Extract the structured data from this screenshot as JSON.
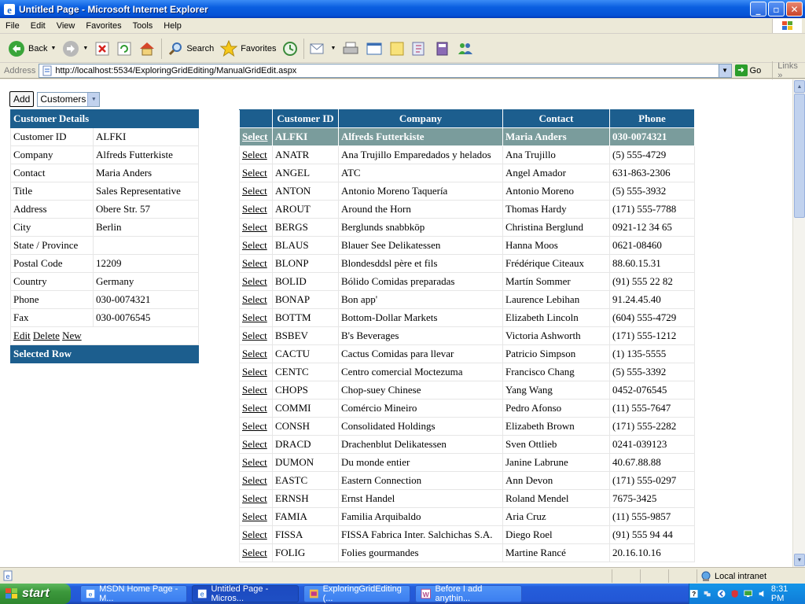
{
  "window": {
    "title": "Untitled Page - Microsoft Internet Explorer"
  },
  "menu": [
    "File",
    "Edit",
    "View",
    "Favorites",
    "Tools",
    "Help"
  ],
  "toolbar": {
    "back": "Back",
    "search": "Search",
    "favorites": "Favorites"
  },
  "address": {
    "label": "Address",
    "url": "http://localhost:5534/ExploringGridEditing/ManualGridEdit.aspx",
    "go": "Go",
    "links": "Links"
  },
  "page": {
    "add_button": "Add",
    "table_select": "Customers",
    "details": {
      "header": "Customer Details",
      "rows": [
        {
          "label": "Customer ID",
          "value": "ALFKI"
        },
        {
          "label": "Company",
          "value": "Alfreds Futterkiste"
        },
        {
          "label": "Contact",
          "value": "Maria Anders"
        },
        {
          "label": "Title",
          "value": "Sales Representative"
        },
        {
          "label": "Address",
          "value": "Obere Str. 57"
        },
        {
          "label": "City",
          "value": "Berlin"
        },
        {
          "label": "State / Province",
          "value": ""
        },
        {
          "label": "Postal Code",
          "value": "12209"
        },
        {
          "label": "Country",
          "value": "Germany"
        },
        {
          "label": "Phone",
          "value": "030-0074321"
        },
        {
          "label": "Fax",
          "value": "030-0076545"
        }
      ],
      "actions": {
        "edit": "Edit",
        "delete": "Delete",
        "new": "New"
      },
      "footer": "Selected Row"
    },
    "grid": {
      "headers": [
        "",
        "Customer ID",
        "Company",
        "Contact",
        "Phone"
      ],
      "select_label": "Select",
      "rows": [
        {
          "id": "ALFKI",
          "company": "Alfreds Futterkiste",
          "contact": "Maria Anders",
          "phone": "030-0074321",
          "selected": true
        },
        {
          "id": "ANATR",
          "company": "Ana Trujillo Emparedados y helados",
          "contact": "Ana Trujillo",
          "phone": "(5) 555-4729"
        },
        {
          "id": "ANGEL",
          "company": "ATC",
          "contact": "Angel Amador",
          "phone": "631-863-2306"
        },
        {
          "id": "ANTON",
          "company": "Antonio Moreno Taquería",
          "contact": "Antonio Moreno",
          "phone": "(5) 555-3932"
        },
        {
          "id": "AROUT",
          "company": "Around the Horn",
          "contact": "Thomas Hardy",
          "phone": "(171) 555-7788"
        },
        {
          "id": "BERGS",
          "company": "Berglunds snabbköp",
          "contact": "Christina Berglund",
          "phone": "0921-12 34 65"
        },
        {
          "id": "BLAUS",
          "company": "Blauer See Delikatessen",
          "contact": "Hanna Moos",
          "phone": "0621-08460"
        },
        {
          "id": "BLONP",
          "company": "Blondesddsl père et fils",
          "contact": "Frédérique Citeaux",
          "phone": "88.60.15.31"
        },
        {
          "id": "BOLID",
          "company": "Bólido Comidas preparadas",
          "contact": "Martín Sommer",
          "phone": "(91) 555 22 82"
        },
        {
          "id": "BONAP",
          "company": "Bon app'",
          "contact": "Laurence Lebihan",
          "phone": "91.24.45.40"
        },
        {
          "id": "BOTTM",
          "company": "Bottom-Dollar Markets",
          "contact": "Elizabeth Lincoln",
          "phone": "(604) 555-4729"
        },
        {
          "id": "BSBEV",
          "company": "B's Beverages",
          "contact": "Victoria Ashworth",
          "phone": "(171) 555-1212"
        },
        {
          "id": "CACTU",
          "company": "Cactus Comidas para llevar",
          "contact": "Patricio Simpson",
          "phone": "(1) 135-5555"
        },
        {
          "id": "CENTC",
          "company": "Centro comercial Moctezuma",
          "contact": "Francisco Chang",
          "phone": "(5) 555-3392"
        },
        {
          "id": "CHOPS",
          "company": "Chop-suey Chinese",
          "contact": "Yang Wang",
          "phone": "0452-076545"
        },
        {
          "id": "COMMI",
          "company": "Comércio Mineiro",
          "contact": "Pedro Afonso",
          "phone": "(11) 555-7647"
        },
        {
          "id": "CONSH",
          "company": "Consolidated Holdings",
          "contact": "Elizabeth Brown",
          "phone": "(171) 555-2282"
        },
        {
          "id": "DRACD",
          "company": "Drachenblut Delikatessen",
          "contact": "Sven Ottlieb",
          "phone": "0241-039123"
        },
        {
          "id": "DUMON",
          "company": "Du monde entier",
          "contact": "Janine Labrune",
          "phone": "40.67.88.88"
        },
        {
          "id": "EASTC",
          "company": "Eastern Connection",
          "contact": "Ann Devon",
          "phone": "(171) 555-0297"
        },
        {
          "id": "ERNSH",
          "company": "Ernst Handel",
          "contact": "Roland Mendel",
          "phone": "7675-3425"
        },
        {
          "id": "FAMIA",
          "company": "Familia Arquibaldo",
          "contact": "Aria Cruz",
          "phone": "(11) 555-9857"
        },
        {
          "id": "FISSA",
          "company": "FISSA Fabrica Inter. Salchichas S.A.",
          "contact": "Diego Roel",
          "phone": "(91) 555 94 44"
        },
        {
          "id": "FOLIG",
          "company": "Folies gourmandes",
          "contact": "Martine Rancé",
          "phone": "20.16.10.16"
        }
      ]
    }
  },
  "status": {
    "zone": "Local intranet"
  },
  "taskbar": {
    "start": "start",
    "tasks": [
      {
        "label": "MSDN Home Page - M...",
        "active": false
      },
      {
        "label": "Untitled Page - Micros...",
        "active": true
      },
      {
        "label": "ExploringGridEditing (...",
        "active": false
      },
      {
        "label": "Before I add anythin...",
        "active": false
      }
    ],
    "clock": "8:31 PM"
  },
  "colors": {
    "grid_header": "#1c5e8e",
    "selected_row": "#7a9c9c",
    "title_bar": "#0a5fe0"
  }
}
